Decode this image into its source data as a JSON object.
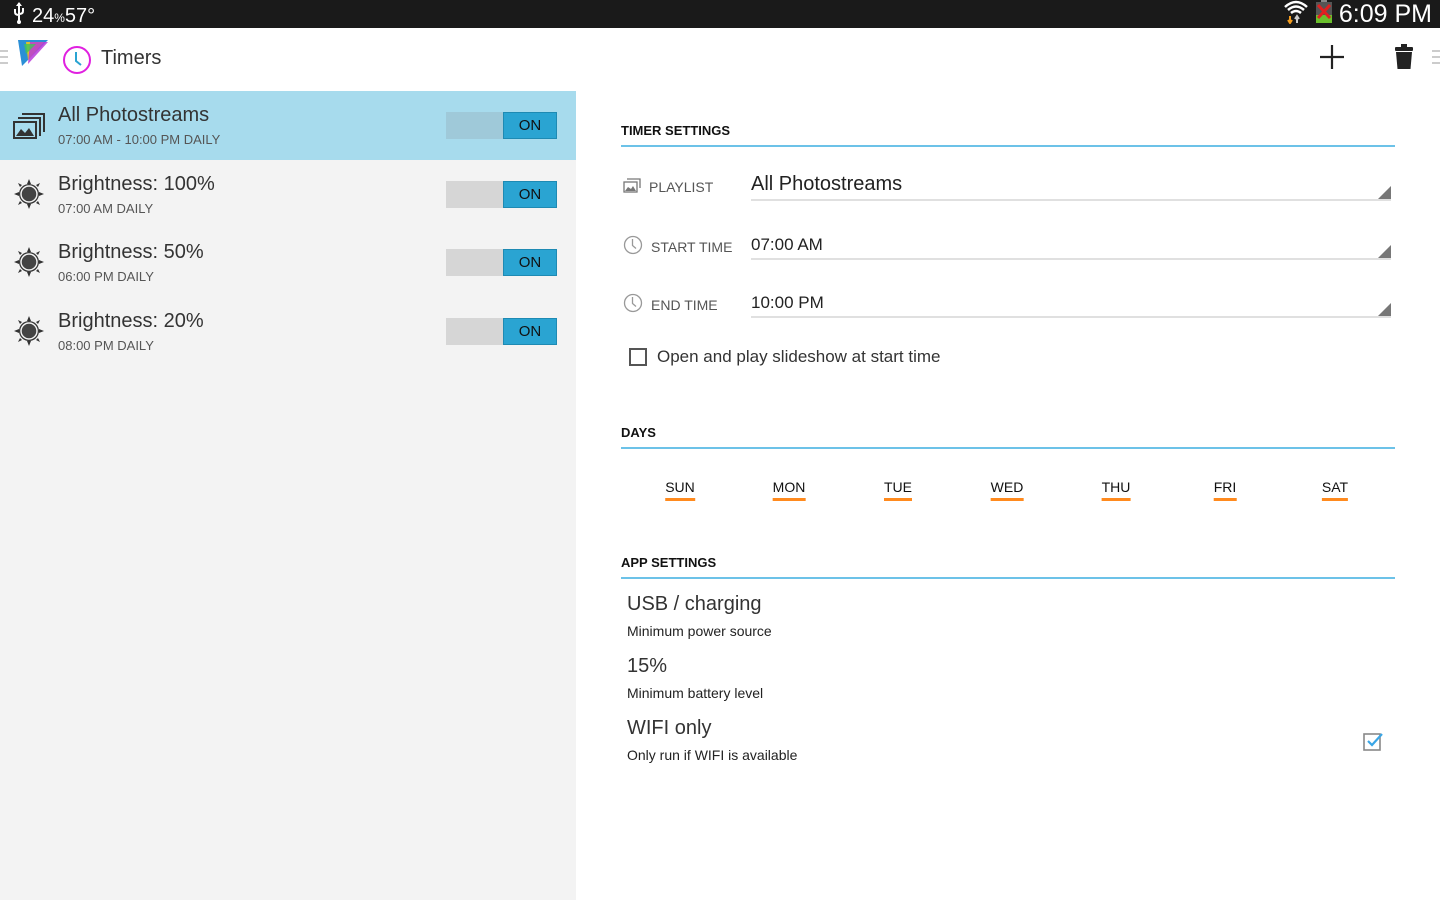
{
  "status_bar": {
    "temperature": "24",
    "temperature_unit_glyph": "%",
    "temperature_value2": "57°",
    "time": "6:09 PM",
    "icons": [
      "usb-icon",
      "wifi-icon",
      "battery-icon"
    ]
  },
  "action_bar": {
    "title": "Timers",
    "add_icon": "plus-icon",
    "delete_icon": "trash-icon"
  },
  "timers": [
    {
      "title": "All Photostreams",
      "subtitle": "07:00 AM - 10:00 PM DAILY",
      "icon": "photostream-icon",
      "toggle": "ON",
      "selected": true
    },
    {
      "title": "Brightness: 100%",
      "subtitle": "07:00 AM DAILY",
      "icon": "brightness-icon",
      "toggle": "ON",
      "selected": false
    },
    {
      "title": "Brightness: 50%",
      "subtitle": "06:00 PM DAILY",
      "icon": "brightness-icon",
      "toggle": "ON",
      "selected": false
    },
    {
      "title": "Brightness: 20%",
      "subtitle": "08:00 PM DAILY",
      "icon": "brightness-icon",
      "toggle": "ON",
      "selected": false
    }
  ],
  "timer_settings": {
    "header": "TIMER SETTINGS",
    "playlist": {
      "label": "PLAYLIST",
      "value": "All Photostreams"
    },
    "start_time": {
      "label": "START TIME",
      "value": "07:00 AM"
    },
    "end_time": {
      "label": "END TIME",
      "value": "10:00 PM"
    },
    "slideshow_checkbox": {
      "label": "Open and play slideshow at start time",
      "checked": false
    }
  },
  "days": {
    "header": "DAYS",
    "items": [
      "SUN",
      "MON",
      "TUE",
      "WED",
      "THU",
      "FRI",
      "SAT"
    ],
    "selected_color": "#ff8a1e"
  },
  "app_settings": {
    "header": "APP SETTINGS",
    "items": [
      {
        "title": "USB / charging",
        "subtitle": "Minimum power source"
      },
      {
        "title": "15%",
        "subtitle": "Minimum battery level"
      },
      {
        "title": "WIFI only",
        "subtitle": "Only run if WIFI is available",
        "checked": true
      }
    ]
  },
  "colors": {
    "accent": "#2aa4d2",
    "selected_row": "#a7dbed",
    "section_line": "#6cc2e8",
    "day_underline": "#ff8a1e"
  }
}
